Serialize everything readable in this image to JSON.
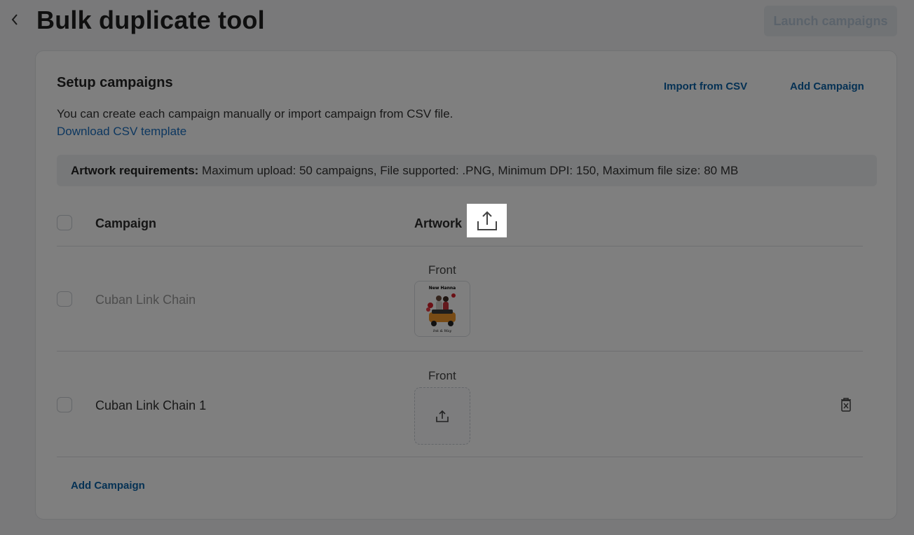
{
  "header": {
    "title": "Bulk duplicate tool",
    "launch_label": "Launch campaigns"
  },
  "setup": {
    "title": "Setup campaigns",
    "import_csv_label": "Import from CSV",
    "add_campaign_label": "Add Campaign",
    "description": "You can create each campaign manually or import campaign from CSV file.",
    "download_template_label": "Download CSV template",
    "requirements_label": "Artwork requirements:",
    "requirements_text": " Maximum upload: 50 campaigns, File supported: .PNG, Minimum DPI: 150, Maximum file size: 80 MB"
  },
  "table": {
    "columns": [
      "Campaign",
      "Artwork"
    ],
    "rows": [
      {
        "name": "Cuban Link Chain",
        "artwork_side": "Front",
        "has_artwork": true,
        "thumb_caption_top": "New Hanna",
        "thumb_caption_bottom": "Ink & Way",
        "deletable": false
      },
      {
        "name": "Cuban Link Chain 1",
        "artwork_side": "Front",
        "has_artwork": false,
        "deletable": true
      }
    ]
  },
  "footer": {
    "add_campaign_label": "Add Campaign"
  },
  "icons": {
    "back": "chevron-left-icon",
    "upload": "upload-icon",
    "delete": "trash-icon"
  },
  "colors": {
    "link": "#0a63a8",
    "overlay": "rgba(0,0,0,0.5)",
    "launch_disabled_text": "#b7c6d6"
  }
}
